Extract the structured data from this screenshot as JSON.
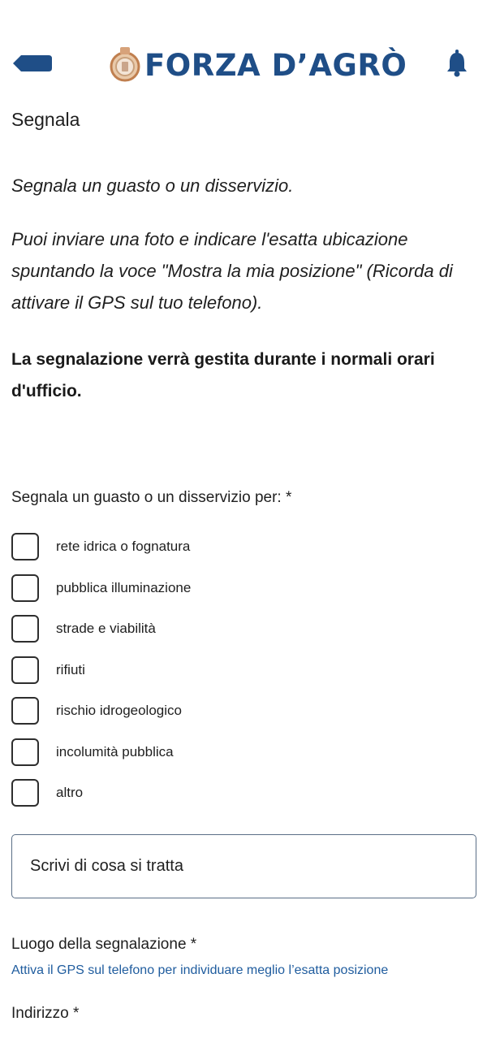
{
  "header": {
    "back_icon": "back-arrow-icon",
    "logo_icon": "coat-of-arms-icon",
    "logo_text": "FORZA D’AGRÒ",
    "bell_icon": "bell-icon",
    "brand_color": "#1f4e87"
  },
  "page": {
    "title": "Segnala",
    "intro": "Segnala un guasto o un disservizio.",
    "instructions": "Puoi inviare una foto e indicare l'esatta ubicazione spuntando la voce \"Mostra la mia posizione\" (Ricorda di attivare il GPS sul tuo telefono).",
    "notice": "La segnalazione verrà gestita durante i normali orari d'ufficio."
  },
  "form": {
    "category_label": "Segnala un guasto o un disservizio per: *",
    "categories": [
      {
        "label": "rete idrica o fognatura",
        "checked": false
      },
      {
        "label": "pubblica illuminazione",
        "checked": false
      },
      {
        "label": "strade e viabilità",
        "checked": false
      },
      {
        "label": "rifiuti",
        "checked": false
      },
      {
        "label": "rischio idrogeologico",
        "checked": false
      },
      {
        "label": "incolumità pubblica",
        "checked": false
      },
      {
        "label": "altro",
        "checked": false
      }
    ],
    "description_placeholder": "Scrivi di cosa si tratta",
    "location_label": "Luogo della segnalazione *",
    "gps_hint": "Attiva il GPS sul telefono per individuare meglio l’esatta posizione",
    "address_label": "Indirizzo *",
    "hint_color": "#1f5c9e"
  }
}
